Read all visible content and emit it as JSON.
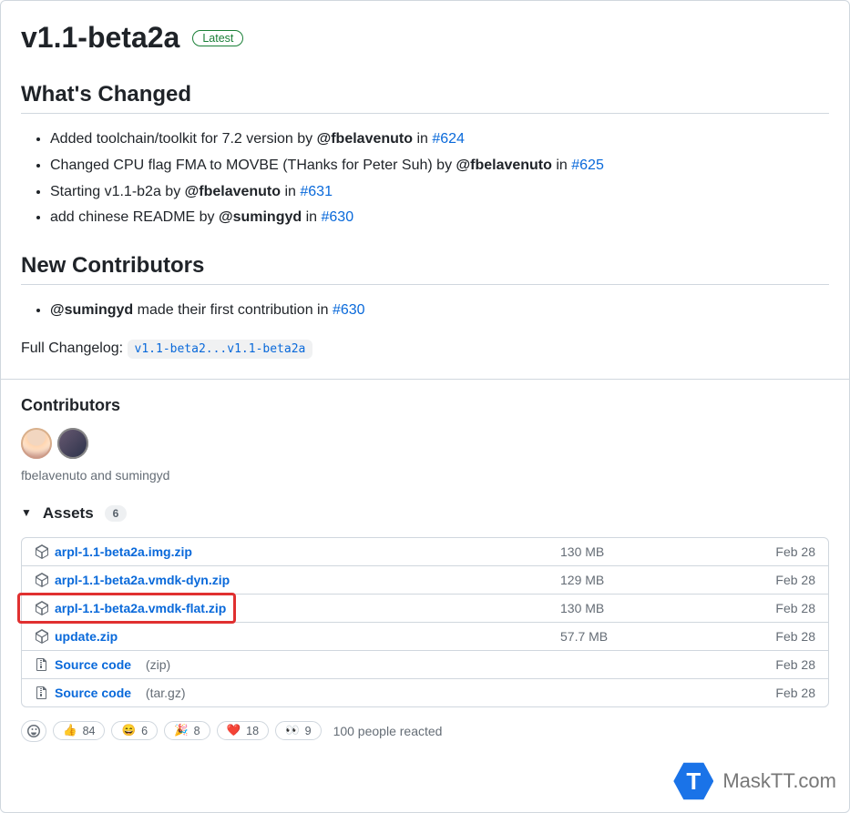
{
  "release": {
    "title": "v1.1-beta2a",
    "badge": "Latest"
  },
  "whats_changed": {
    "heading": "What's Changed",
    "items": [
      {
        "prefix": "Added toolchain/toolkit for 7.2 version by ",
        "mention": "@fbelavenuto",
        "mid": " in ",
        "link": "#624"
      },
      {
        "prefix": "Changed CPU flag FMA to MOVBE (THanks for Peter Suh) by ",
        "mention": "@fbelavenuto",
        "mid": " in ",
        "link": "#625"
      },
      {
        "prefix": "Starting v1.1-b2a by ",
        "mention": "@fbelavenuto",
        "mid": " in ",
        "link": "#631"
      },
      {
        "prefix": "add chinese README by ",
        "mention": "@sumingyd",
        "mid": " in ",
        "link": "#630"
      }
    ]
  },
  "new_contributors": {
    "heading": "New Contributors",
    "items": [
      {
        "mention": "@sumingyd",
        "rest": " made their first contribution in ",
        "link": "#630"
      }
    ]
  },
  "changelog": {
    "label": "Full Changelog: ",
    "ref": "v1.1-beta2...v1.1-beta2a"
  },
  "contributors": {
    "heading": "Contributors",
    "names": "fbelavenuto and sumingyd"
  },
  "assets": {
    "heading": "Assets",
    "count": "6",
    "rows": [
      {
        "name": "arpl-1.1-beta2a.img.zip",
        "size": "130 MB",
        "date": "Feb 28"
      },
      {
        "name": "arpl-1.1-beta2a.vmdk-dyn.zip",
        "size": "129 MB",
        "date": "Feb 28"
      },
      {
        "name": "arpl-1.1-beta2a.vmdk-flat.zip",
        "size": "130 MB",
        "date": "Feb 28"
      },
      {
        "name": "update.zip",
        "size": "57.7 MB",
        "date": "Feb 28"
      },
      {
        "name": "Source code",
        "suffix": "(zip)",
        "size": "",
        "date": "Feb 28"
      },
      {
        "name": "Source code",
        "suffix": "(tar.gz)",
        "size": "",
        "date": "Feb 28"
      }
    ]
  },
  "reactions": {
    "items": [
      {
        "emoji": "👍",
        "count": "84"
      },
      {
        "emoji": "😄",
        "count": "6"
      },
      {
        "emoji": "🎉",
        "count": "8"
      },
      {
        "emoji": "❤️",
        "count": "18"
      },
      {
        "emoji": "👀",
        "count": "9"
      }
    ],
    "summary": "100 people reacted"
  },
  "watermark": {
    "letter": "T",
    "text": "MaskTT.com"
  }
}
